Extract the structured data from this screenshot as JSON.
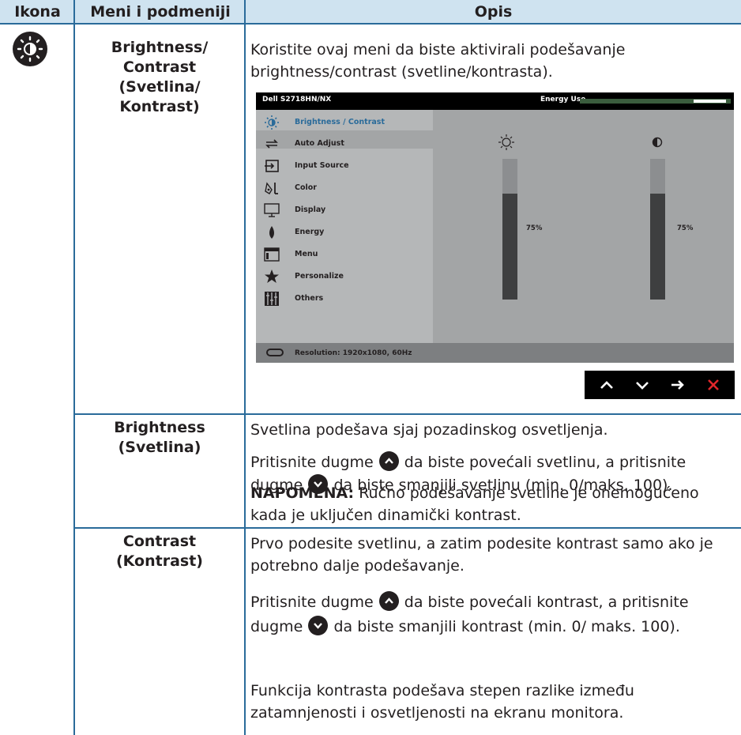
{
  "table": {
    "headers": [
      "Ikona",
      "Meni i podmeniji",
      "Opis"
    ]
  },
  "rows": {
    "brightness_contrast": {
      "menu_name": "Brightness/\nContrast\n(Svetlina/\nKontrast)",
      "description": "Koristite ovaj meni da biste aktivirali podešavanje brightness/contrast (svetline/kontrasta)."
    },
    "brightness": {
      "menu_name": "Brightness\n(Svetlina)",
      "p1": "Svetlina podešava sjaj pozadinskog osvetljenja.",
      "p2_a": "Pritisnite dugme",
      "p2_b": "da biste povećali svetlinu, a pritisnite dugme",
      "p2_c": "da biste smanjili svetlinu (min. 0/maks. 100).",
      "note_label": "NAPOMENA:",
      "note_text": "Ručno podešavanje svetline je onemogućeno kada je uključen dinamički kontrast."
    },
    "contrast": {
      "menu_name": "Contrast\n(Kontrast)",
      "p1": "Prvo podesite svetlinu, a zatim podesite kontrast samo ako je potrebno dalje podešavanje.",
      "p2_a": "Pritisnite dugme",
      "p2_b": "da biste povećali kontrast, a pritisnite dugme",
      "p2_c": "da biste smanjili kontrast (min. 0/ maks. 100).",
      "p3": "Funkcija kontrasta podešava stepen razlike između zatamnjenosti i osvetljenosti na ekranu monitora."
    }
  },
  "osd": {
    "model": "Dell S2718HN/NX",
    "energy_label": "Energy Use",
    "menu_items": [
      {
        "label": "Brightness / Contrast",
        "icon": "brightness-icon",
        "selected": true
      },
      {
        "label": "Auto Adjust",
        "icon": "auto-adjust-icon",
        "selected": false
      },
      {
        "label": "Input Source",
        "icon": "input-source-icon",
        "selected": false
      },
      {
        "label": "Color",
        "icon": "color-icon",
        "selected": false
      },
      {
        "label": "Display",
        "icon": "display-icon",
        "selected": false
      },
      {
        "label": "Energy",
        "icon": "energy-icon",
        "selected": false
      },
      {
        "label": "Menu",
        "icon": "menu-icon",
        "selected": false
      },
      {
        "label": "Personalize",
        "icon": "star-icon",
        "selected": false
      },
      {
        "label": "Others",
        "icon": "others-icon",
        "selected": false
      }
    ],
    "brightness_value": "75%",
    "contrast_value": "75%",
    "brightness_level": 0.75,
    "contrast_level": 0.75,
    "resolution": "Resolution: 1920x1080, 60Hz"
  },
  "buttons": [
    "up-arrow-icon",
    "down-arrow-icon",
    "right-arrow-icon",
    "close-icon"
  ],
  "colors": {
    "header_bg": "#cfe3f0",
    "rule": "#2a6b9a",
    "selected_item": "#2a6b9a",
    "close": "#e0262b"
  }
}
